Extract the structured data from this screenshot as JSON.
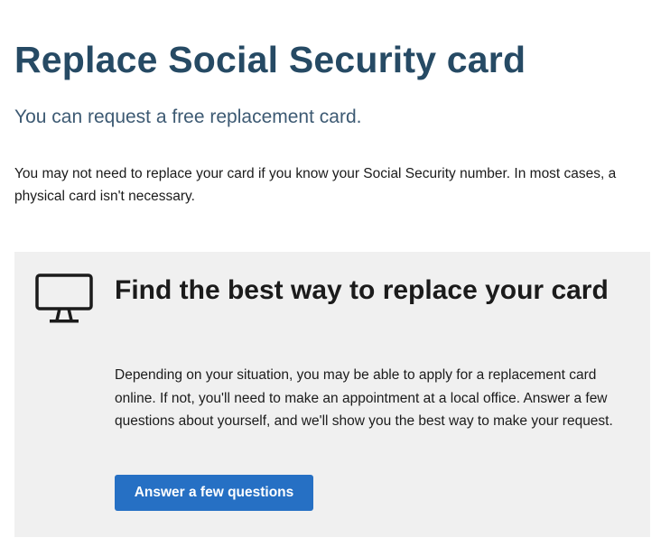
{
  "page": {
    "title": "Replace Social Security card",
    "lead": "You can request a free replacement card.",
    "intro": "You may not need to replace your card if you know your Social Security number. In most cases, a physical card isn't necessary."
  },
  "card": {
    "icon": "desktop-computer-icon",
    "title": "Find the best way to replace your card",
    "body": "Depending on your situation, you may be able to apply for a replacement card online. If not, you'll need to make an appointment at a local office. Answer a few questions about yourself, and we'll show you the best way to make your request.",
    "button_label": "Answer a few questions"
  },
  "colors": {
    "title": "#264a64",
    "lead": "#3d5a73",
    "card_background": "#f0f0f0",
    "button": "#2670c4"
  }
}
